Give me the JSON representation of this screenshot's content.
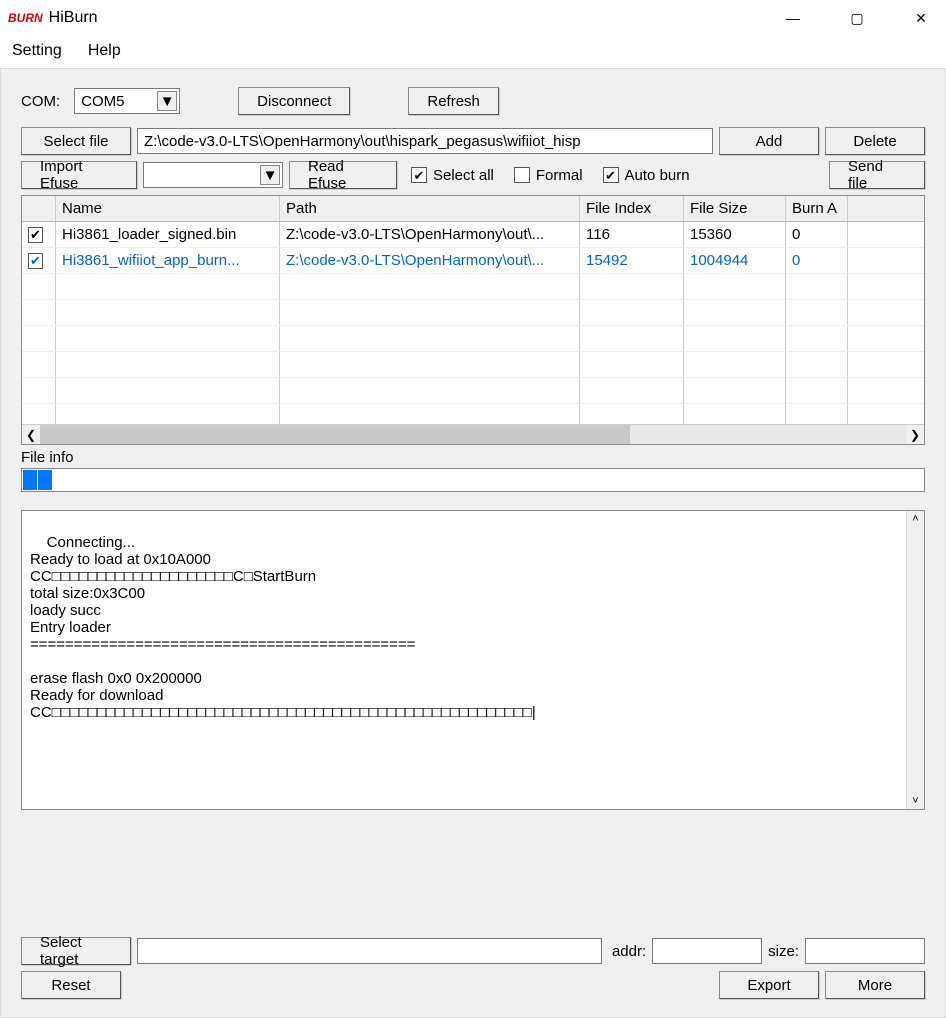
{
  "app": {
    "logo": "BURN",
    "title": "HiBurn"
  },
  "menu": {
    "setting": "Setting",
    "help": "Help"
  },
  "toolbar": {
    "com_label": "COM:",
    "com_value": "COM5",
    "disconnect": "Disconnect",
    "refresh": "Refresh"
  },
  "filerow": {
    "select_file": "Select file",
    "path_value": "Z:\\code-v3.0-LTS\\OpenHarmony\\out\\hispark_pegasus\\wifiiot_hisp",
    "add": "Add",
    "delete": "Delete"
  },
  "efuserow": {
    "import_efuse": "Import Efuse",
    "efuse_value": "",
    "read_efuse": "Read Efuse",
    "select_all": "Select all",
    "formal": "Formal",
    "auto_burn": "Auto burn",
    "send_file": "Send file",
    "select_all_checked": true,
    "formal_checked": false,
    "auto_burn_checked": true
  },
  "table": {
    "cols": {
      "name": "Name",
      "path": "Path",
      "file_index": "File Index",
      "file_size": "File Size",
      "burn_addr": "Burn A"
    },
    "rows": [
      {
        "checked": true,
        "name": "Hi3861_loader_signed.bin",
        "path": "Z:\\code-v3.0-LTS\\OpenHarmony\\out\\...",
        "index": "116",
        "size": "15360",
        "burn": "0",
        "selected": false
      },
      {
        "checked": true,
        "name": "Hi3861_wifiiot_app_burn...",
        "path": "Z:\\code-v3.0-LTS\\OpenHarmony\\out\\...",
        "index": "15492",
        "size": "1004944",
        "burn": "0",
        "selected": true
      }
    ]
  },
  "fileinfo": {
    "label": "File info"
  },
  "log": {
    "text": "Connecting...\nReady to load at 0x10A000\nCC□□□□□□□□□□□□□□□□□□□□C□StartBurn\ntotal size:0x3C00\nloady succ\nEntry loader\n============================================\n\nerase flash 0x0 0x200000\nReady for download\nCC□□□□□□□□□□□□□□□□□□□□□□□□□□□□□□□□□□□□□□□□□□□□□□□□□□□□□|"
  },
  "bottom": {
    "select_target": "Select target",
    "target_value": "",
    "addr_label": "addr:",
    "addr_value": "",
    "size_label": "size:",
    "size_value": "",
    "reset": "Reset",
    "export": "Export",
    "more": "More"
  }
}
